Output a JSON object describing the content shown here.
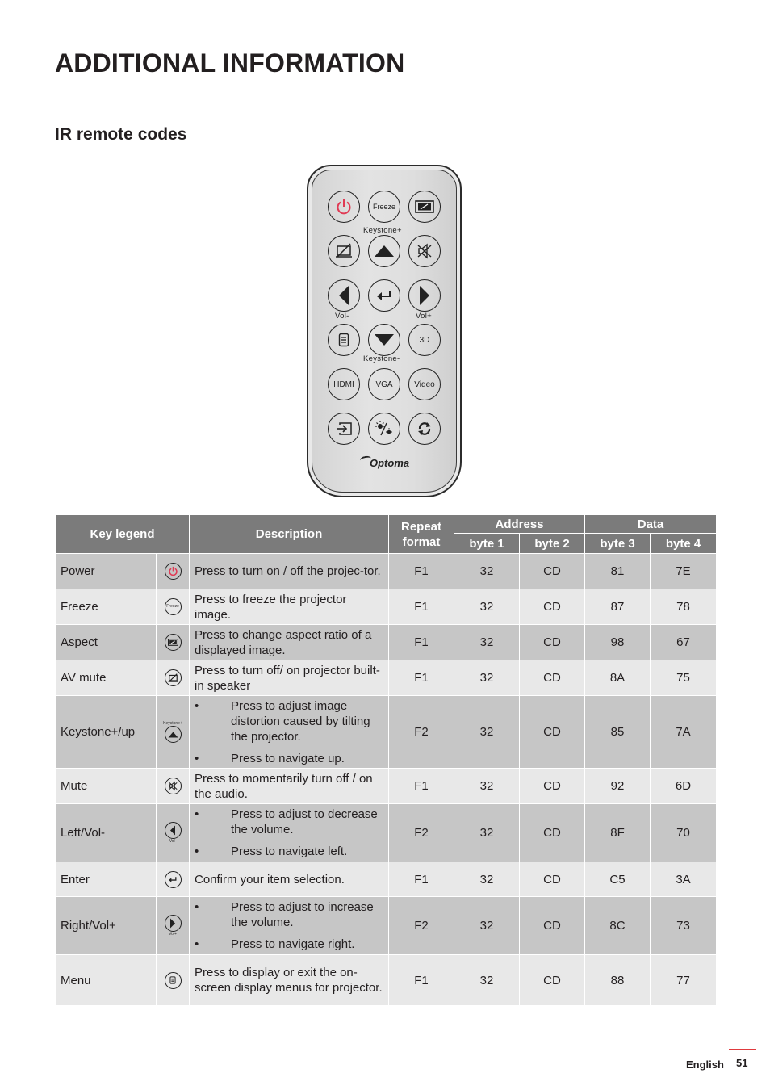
{
  "page": {
    "title": "ADDITIONAL INFORMATION",
    "section_title": "IR remote codes"
  },
  "remote": {
    "brand": "Optoma",
    "accent_color": "#e03a54",
    "buttons": [
      {
        "id": "power",
        "icon": "power-icon",
        "label": ""
      },
      {
        "id": "freeze",
        "icon": "",
        "label": "Freeze"
      },
      {
        "id": "aspect",
        "icon": "aspect-ratio-icon",
        "label": ""
      },
      {
        "id": "av-mute",
        "icon": "av-mute-icon",
        "label": ""
      },
      {
        "id": "keystone-up",
        "icon": "triangle-up-icon",
        "label": ""
      },
      {
        "id": "mute",
        "icon": "speaker-mute-icon",
        "label": ""
      },
      {
        "id": "left",
        "icon": "triangle-left-icon",
        "label": ""
      },
      {
        "id": "enter",
        "icon": "enter-icon",
        "label": ""
      },
      {
        "id": "right",
        "icon": "triangle-right-icon",
        "label": ""
      },
      {
        "id": "menu",
        "icon": "menu-icon",
        "label": ""
      },
      {
        "id": "keystone-down",
        "icon": "triangle-down-icon",
        "label": ""
      },
      {
        "id": "3d",
        "icon": "",
        "label": "3D"
      },
      {
        "id": "hdmi",
        "icon": "",
        "label": "HDMI"
      },
      {
        "id": "vga",
        "icon": "",
        "label": "VGA"
      },
      {
        "id": "video",
        "icon": "",
        "label": "Video"
      },
      {
        "id": "source",
        "icon": "source-icon",
        "label": ""
      },
      {
        "id": "brightness",
        "icon": "brightness-icon",
        "label": ""
      },
      {
        "id": "resync",
        "icon": "resync-icon",
        "label": ""
      }
    ],
    "labels": {
      "keystone_plus": "Keystone+",
      "keystone_minus": "Keystone-",
      "vol_minus": "Vol-",
      "vol_plus": "Vol+"
    }
  },
  "table": {
    "headers": {
      "key_legend": "Key legend",
      "description": "Description",
      "repeat_format": "Repeat format",
      "address": "Address",
      "data": "Data",
      "byte1": "byte 1",
      "byte2": "byte 2",
      "byte3": "byte 3",
      "byte4": "byte 4"
    },
    "rows": [
      {
        "key": "Power",
        "icon": "power-icon",
        "description": "Press to turn on / off the projec-tor.",
        "bullets": [],
        "repeat": "F1",
        "byte1": "32",
        "byte2": "CD",
        "byte3": "81",
        "byte4": "7E"
      },
      {
        "key": "Freeze",
        "icon": "freeze-icon",
        "icon_text": "Freeze",
        "description": "Press to freeze the projector image.",
        "bullets": [],
        "repeat": "F1",
        "byte1": "32",
        "byte2": "CD",
        "byte3": "87",
        "byte4": "78"
      },
      {
        "key": "Aspect",
        "icon": "aspect-ratio-icon",
        "description": "Press to change aspect ratio of a displayed image.",
        "bullets": [],
        "repeat": "F1",
        "byte1": "32",
        "byte2": "CD",
        "byte3": "98",
        "byte4": "67"
      },
      {
        "key": "AV mute",
        "icon": "av-mute-icon",
        "description": "Press to turn off/ on projector built-in speaker",
        "bullets": [],
        "repeat": "F1",
        "byte1": "32",
        "byte2": "CD",
        "byte3": "8A",
        "byte4": "75"
      },
      {
        "key": "Keystone+/up",
        "icon": "triangle-up-icon",
        "icon_caption": "Keystone+",
        "description": "",
        "bullets": [
          "Press to adjust image distortion caused by tilting the projector.",
          "Press to navigate up."
        ],
        "repeat": "F2",
        "byte1": "32",
        "byte2": "CD",
        "byte3": "85",
        "byte4": "7A"
      },
      {
        "key": "Mute",
        "icon": "speaker-mute-icon",
        "description": "Press to momentarily turn off / on the audio.",
        "bullets": [],
        "repeat": "F1",
        "byte1": "32",
        "byte2": "CD",
        "byte3": "92",
        "byte4": "6D"
      },
      {
        "key": "Left/Vol-",
        "icon": "triangle-left-icon",
        "icon_caption": "Vol-",
        "description": "",
        "bullets": [
          "Press to adjust to decrease the volume.",
          "Press to navigate left."
        ],
        "repeat": "F2",
        "byte1": "32",
        "byte2": "CD",
        "byte3": "8F",
        "byte4": "70"
      },
      {
        "key": "Enter",
        "icon": "enter-icon",
        "description": "Confirm your item selection.",
        "bullets": [],
        "repeat": "F1",
        "byte1": "32",
        "byte2": "CD",
        "byte3": "C5",
        "byte4": "3A"
      },
      {
        "key": "Right/Vol+",
        "icon": "triangle-right-icon",
        "icon_caption": "Vol+",
        "description": "",
        "bullets": [
          "Press to adjust to increase the volume.",
          "Press to navigate right."
        ],
        "repeat": "F2",
        "byte1": "32",
        "byte2": "CD",
        "byte3": "8C",
        "byte4": "73"
      },
      {
        "key": "Menu",
        "icon": "menu-icon",
        "description": "Press to display or exit the on-screen display menus for projector.",
        "bullets": [],
        "repeat": "F1",
        "byte1": "32",
        "byte2": "CD",
        "byte3": "88",
        "byte4": "77"
      }
    ],
    "colors": {
      "header_bg": "#7b7b7b",
      "row_dark": "#c6c6c6",
      "row_light": "#e8e8e8"
    }
  },
  "footer": {
    "language": "English",
    "page_number": "51",
    "accent_color": "#e03a3e"
  }
}
